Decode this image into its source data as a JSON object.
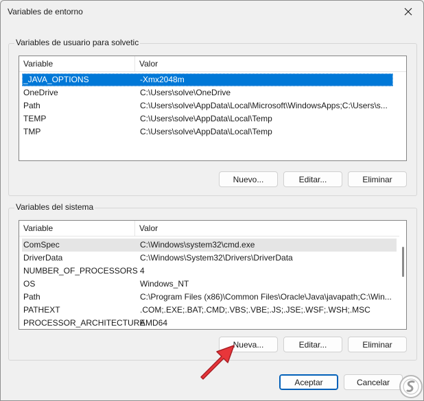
{
  "window": {
    "title": "Variables de entorno"
  },
  "user_group": {
    "label": "Variables de usuario para solvetic",
    "columns": [
      "Variable",
      "Valor"
    ],
    "rows": [
      {
        "variable": "_JAVA_OPTIONS",
        "valor": "-Xmx2048m",
        "selected": true
      },
      {
        "variable": "OneDrive",
        "valor": "C:\\Users\\solve\\OneDrive"
      },
      {
        "variable": "Path",
        "valor": "C:\\Users\\solve\\AppData\\Local\\Microsoft\\WindowsApps;C:\\Users\\s..."
      },
      {
        "variable": "TEMP",
        "valor": "C:\\Users\\solve\\AppData\\Local\\Temp"
      },
      {
        "variable": "TMP",
        "valor": "C:\\Users\\solve\\AppData\\Local\\Temp"
      }
    ],
    "buttons": {
      "new": "Nuevo...",
      "edit": "Editar...",
      "delete": "Eliminar"
    }
  },
  "system_group": {
    "label": "Variables del sistema",
    "columns": [
      "Variable",
      "Valor"
    ],
    "rows": [
      {
        "variable": "ComSpec",
        "valor": "C:\\Windows\\system32\\cmd.exe",
        "hover": true
      },
      {
        "variable": "DriverData",
        "valor": "C:\\Windows\\System32\\Drivers\\DriverData"
      },
      {
        "variable": "NUMBER_OF_PROCESSORS",
        "valor": "4"
      },
      {
        "variable": "OS",
        "valor": "Windows_NT"
      },
      {
        "variable": "Path",
        "valor": "C:\\Program Files (x86)\\Common Files\\Oracle\\Java\\javapath;C:\\Win..."
      },
      {
        "variable": "PATHEXT",
        "valor": ".COM;.EXE;.BAT;.CMD;.VBS;.VBE;.JS;.JSE;.WSF;.WSH;.MSC"
      },
      {
        "variable": "PROCESSOR_ARCHITECTURE",
        "valor": "AMD64"
      }
    ],
    "buttons": {
      "new": "Nueva...",
      "edit": "Editar...",
      "delete": "Eliminar"
    }
  },
  "footer": {
    "ok": "Aceptar",
    "cancel": "Cancelar"
  },
  "icons": {
    "close": "close-icon",
    "pointer": "red-arrow-icon",
    "logo": "solvetic-logo-icon"
  },
  "colors": {
    "selection": "#0078d7",
    "primary_border": "#005fb8",
    "arrow": "#e8363a"
  }
}
